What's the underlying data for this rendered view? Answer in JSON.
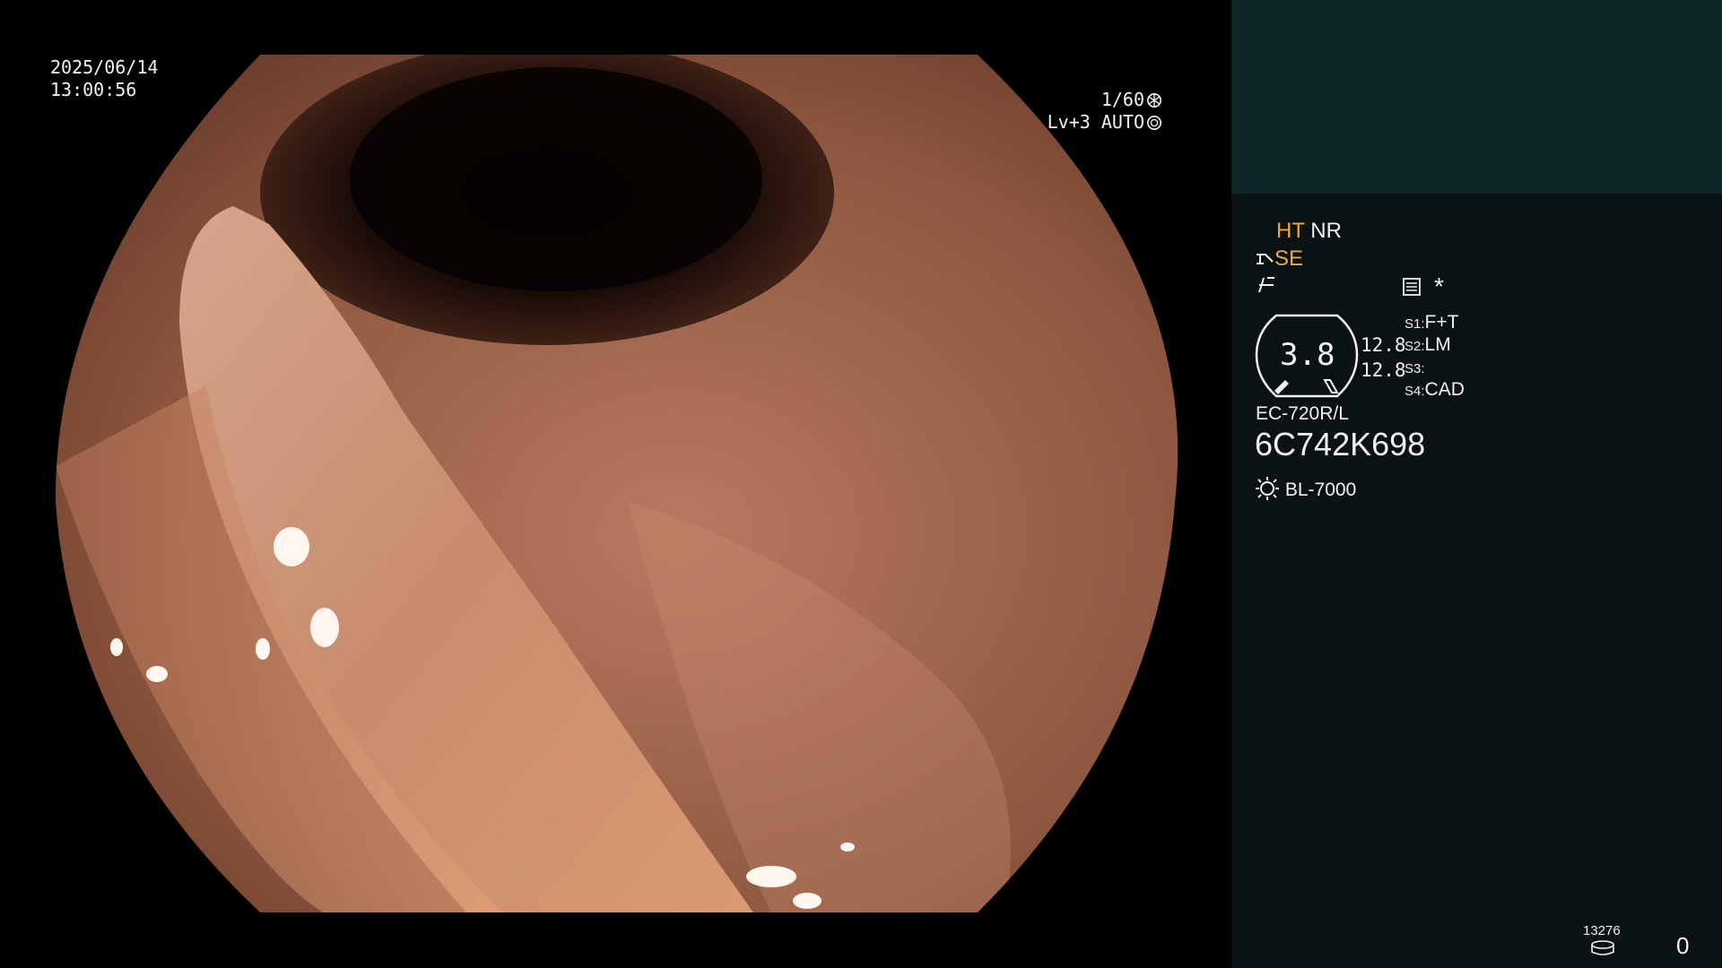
{
  "overlay": {
    "date": "2025/06/14",
    "time": "13:00:56",
    "shutter": "1/60",
    "level_mode": "Lv+3 AUTO",
    "shutter_icon": "shutter-icon",
    "auto_icon": "iris-icon"
  },
  "panel": {
    "mode_primary": "HT",
    "mode_secondary": "NR",
    "structure_mode": "SE",
    "scope_icon": "scope-icon",
    "contrast_icon": "contrast-icon",
    "menu_icon": "menu-icon",
    "star": "*",
    "gauge_value": "3.8",
    "scale_top": "12.8",
    "scale_bottom": "12.8",
    "switches": [
      {
        "key": "S1",
        "value": "F+T"
      },
      {
        "key": "S2",
        "value": "LM"
      },
      {
        "key": "S3",
        "value": ""
      },
      {
        "key": "S4",
        "value": "CAD"
      }
    ],
    "scope_model": "EC-720R/L",
    "serial": "6C742K698",
    "light_source": "BL-7000",
    "light_icon": "light-source-icon",
    "storage_count": "13276",
    "storage_icon": "storage-icon",
    "frame_counter": "0"
  },
  "colors": {
    "panel_bg": "#0a1213",
    "panel_top": "#0e2728",
    "accent_orange": "#f0a83a"
  }
}
